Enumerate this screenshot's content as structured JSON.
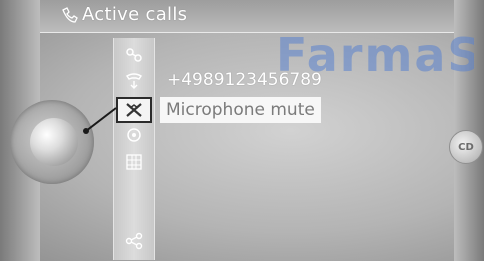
{
  "header": {
    "title": "Active calls",
    "title_icon": "phone-icon"
  },
  "watermark": "FarmaS",
  "call": {
    "number": "+4989123456789"
  },
  "selected_item": {
    "label": "Microphone mute"
  },
  "menu_icons": [
    "call-options-icon",
    "hold-icon",
    "microphone-mute-icon",
    "speaker-icon",
    "keypad-icon",
    "share-icon"
  ],
  "right_knob": {
    "icon": "cd-icon",
    "label": "CD"
  },
  "colors": {
    "accent": "#ffffff",
    "watermark": "#5a82cd",
    "selection_bg": "#f7f7f7"
  }
}
